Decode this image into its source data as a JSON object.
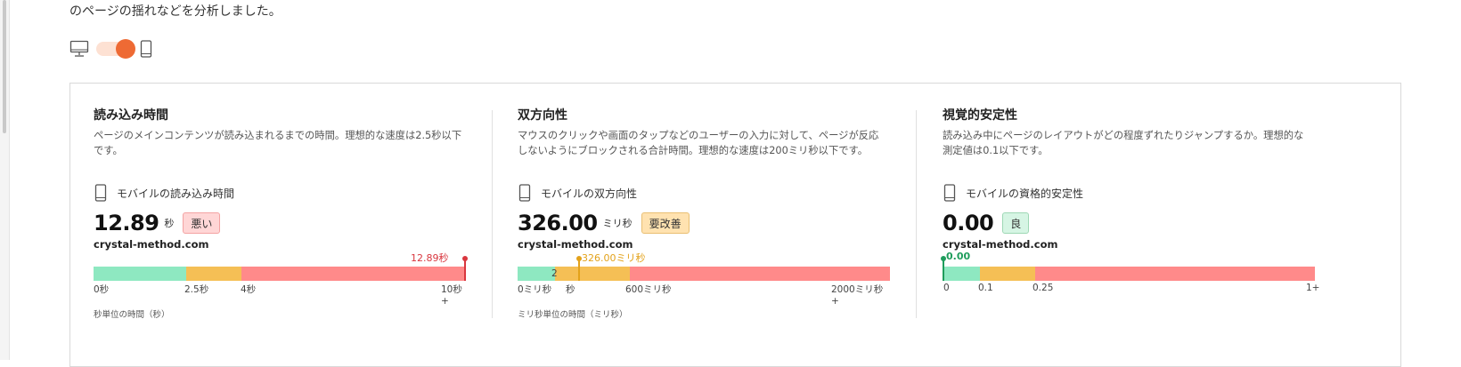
{
  "intro_text": "のページの揺れなどを分析しました。",
  "device_toggle": {
    "desktop_icon": "desktop-icon",
    "mobile_icon": "mobile-icon",
    "selected": "mobile",
    "accent_color": "#ee6a34"
  },
  "metrics": [
    {
      "title": "読み込み時間",
      "description_line1": "ページのメインコンテンツが読み込まれるまでの時間。理想的な速度は2.5秒以下",
      "description_line2": "です。",
      "subtitle": "モバイルの読み込み時間",
      "value": "12.89",
      "unit": "秒",
      "badge": "悪い",
      "site": "crystal-method.com",
      "marker_label": "12.89秒",
      "marker_color": "#d9363e",
      "ticks": [
        "0秒",
        "2.5秒",
        "4秒",
        "10秒+"
      ],
      "axis_title": "秒単位の時間（秒）"
    },
    {
      "title": "双方向性",
      "description_line1": "マウスのクリックや画面のタップなどのユーザーの入力に対して、ページが反応",
      "description_line2": "しないようにブロックされる合計時間。理想的な速度は200ミリ秒以下です。",
      "subtitle": "モバイルの双方向性",
      "value": "326.00",
      "unit": "ミリ秒",
      "badge": "要改善",
      "site": "crystal-method.com",
      "marker_label": "326.00ミリ秒",
      "marker_color": "#e3a21a",
      "ticks": [
        "0ミリ秒",
        "2",
        "秒",
        "600ミリ秒",
        "2000ミリ秒+"
      ],
      "axis_title": "ミリ秒単位の時間（ミリ秒）"
    },
    {
      "title": "視覚的安定性",
      "description_line1": "読み込み中にページのレイアウトがどの程度ずれたりジャンプするか。理想的な",
      "description_line2": "測定値は0.1以下です。",
      "subtitle": "モバイルの資格的安定性",
      "value": "0.00",
      "unit": "",
      "badge": "良",
      "site": "crystal-method.com",
      "marker_label": "0.00",
      "marker_color": "#1f9d5c",
      "ticks": [
        "0",
        "0.1",
        "0.25",
        "1+"
      ],
      "axis_title": ""
    }
  ]
}
